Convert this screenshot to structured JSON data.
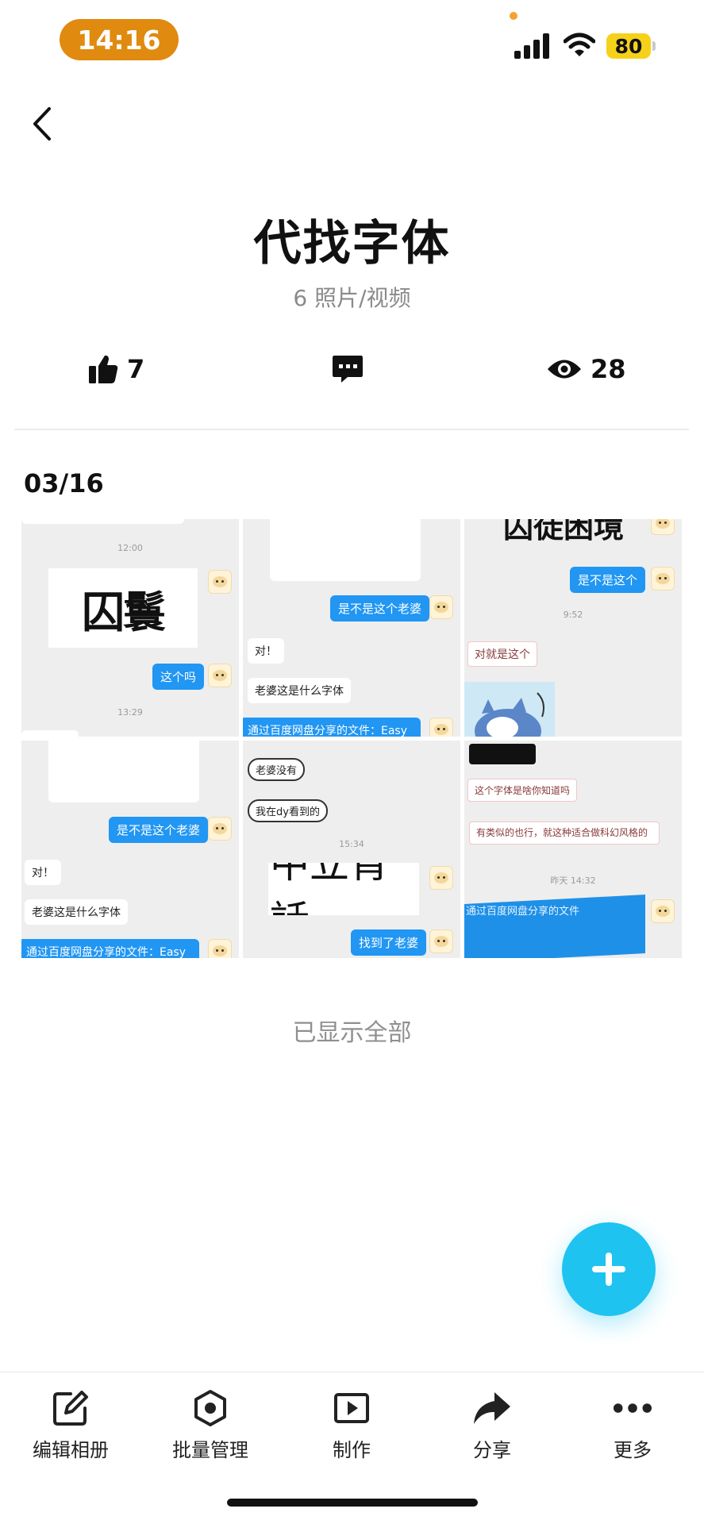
{
  "status_bar": {
    "time": "14:16",
    "battery": "80"
  },
  "album": {
    "title": "代找字体",
    "count_text": "6 照片/视频"
  },
  "stats": {
    "likes": "7",
    "views": "28"
  },
  "section": {
    "date": "03/16"
  },
  "photos": {
    "p1": {
      "ts1": "12:00",
      "glyph": "囚鬟",
      "bubble": "这个吗",
      "ts2": "13:29"
    },
    "p2": {
      "bubble": "是不是这个老婆",
      "reply1": "对！",
      "reply2": "老婆这是什么字体",
      "share": "通过百度网盘分享的文件：Easy"
    },
    "p3": {
      "glyph": "囚徒困境",
      "bubble": "是不是这个",
      "ts": "9:52",
      "reply": "对就是这个"
    },
    "p4": {
      "bubble": "是不是这个老婆",
      "reply1": "对！",
      "reply2": "老婆这是什么字体",
      "share": "通过百度网盘分享的文件：Easy"
    },
    "p5": {
      "hand1": "老婆没有",
      "hand2": "我在dy看到的",
      "ts": "15:34",
      "glyph": "中立宵話",
      "bubble": "找到了老婆"
    },
    "p6": {
      "msg1": "这个字体是啥你知道吗",
      "msg2": "有类似的也行，就这种适合做科幻风格的",
      "ts": "昨天 14:32",
      "share": "通过百度网盘分享的文件"
    }
  },
  "footer": {
    "shown_all": "已显示全部"
  },
  "bottom_nav": {
    "edit": "编辑相册",
    "batch": "批量管理",
    "make": "制作",
    "share": "分享",
    "more": "更多"
  },
  "colors": {
    "accent": "#1ec3f0",
    "time_pill": "#e08a0f",
    "battery": "#f6d11a",
    "chat_blue": "#2196f3"
  },
  "icons": [
    "back-icon",
    "thumbs-up-icon",
    "comment-icon",
    "eye-icon",
    "plus-icon",
    "edit-icon",
    "batch-icon",
    "play-icon",
    "share-icon",
    "more-icon"
  ]
}
